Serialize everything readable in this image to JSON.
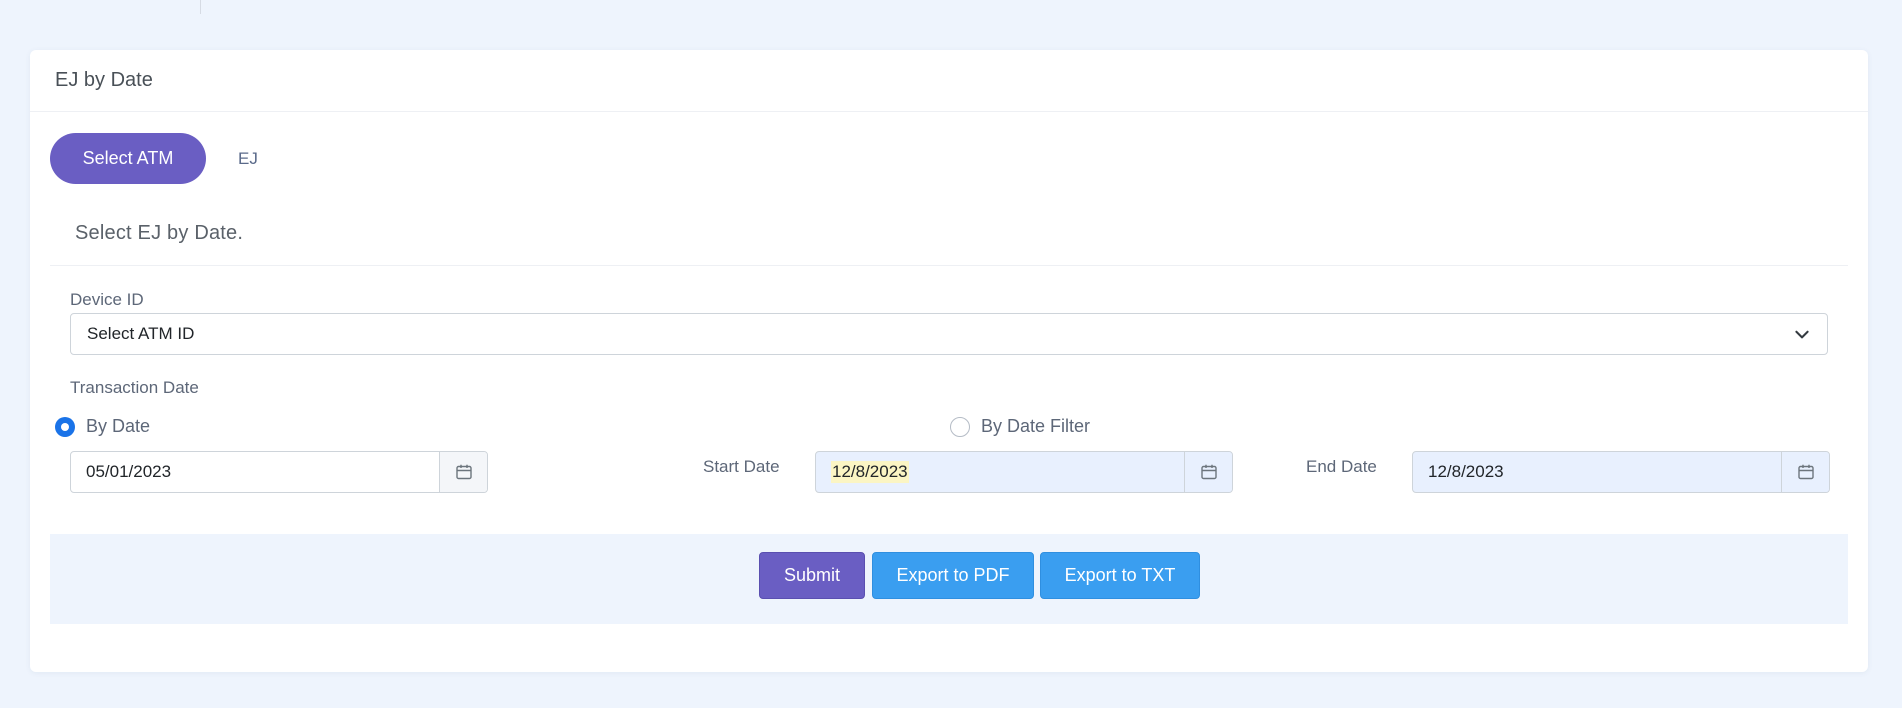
{
  "card": {
    "title": "EJ by Date"
  },
  "tabs": [
    {
      "label": "Select ATM",
      "active": true
    },
    {
      "label": "EJ",
      "active": false
    }
  ],
  "subtitle": "Select EJ by Date.",
  "form": {
    "device_label": "Device ID",
    "device_select_value": "Select ATM ID",
    "transaction_label": "Transaction Date",
    "radio_by_date": {
      "label": "By Date",
      "checked": true
    },
    "radio_by_date_filter": {
      "label": "By Date Filter",
      "checked": false
    },
    "date_value": "05/01/2023",
    "start_date_label": "Start Date",
    "start_date_value": "12/8/2023",
    "end_date_label": "End Date",
    "end_date_value": "12/8/2023"
  },
  "actions": {
    "submit_label": "Submit",
    "export_pdf_label": "Export to PDF",
    "export_txt_label": "Export to TXT"
  },
  "colors": {
    "page_background": "#eef4fd",
    "primary": "#6a5ec3",
    "info": "#3a9ef0",
    "radio_checked": "#1a73e8"
  },
  "icons": {
    "calendar": "calendar-icon",
    "dropdown": "chevron-down-icon"
  }
}
